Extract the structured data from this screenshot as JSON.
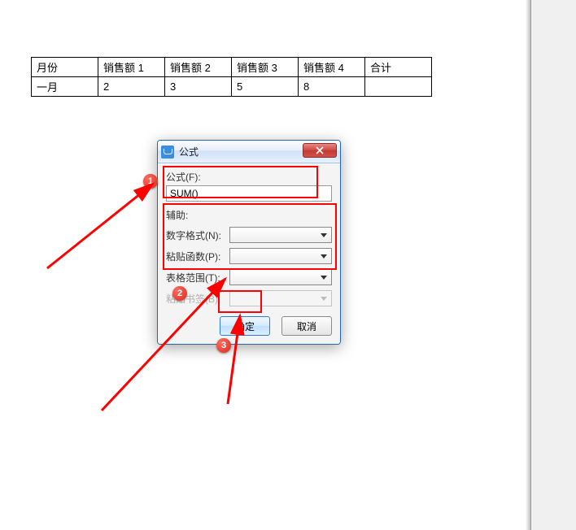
{
  "table": {
    "headers": [
      "月份",
      "销售额 1",
      "销售额 2",
      "销售额 3",
      "销售额 4",
      "合计"
    ],
    "rows": [
      [
        "一月",
        "2",
        "3",
        "5",
        "8",
        ""
      ]
    ]
  },
  "dialog": {
    "title": "公式",
    "formula_label": "公式(F):",
    "formula_value": "SUM()",
    "assist_label": "辅助:",
    "number_format_label": "数字格式(N):",
    "paste_function_label": "粘贴函数(P):",
    "table_range_label": "表格范围(T):",
    "paste_bookmark_label": "粘贴书签(B):",
    "ok": "确定",
    "cancel": "取消"
  },
  "callouts": {
    "c1": "1",
    "c2": "2",
    "c3": "3"
  }
}
